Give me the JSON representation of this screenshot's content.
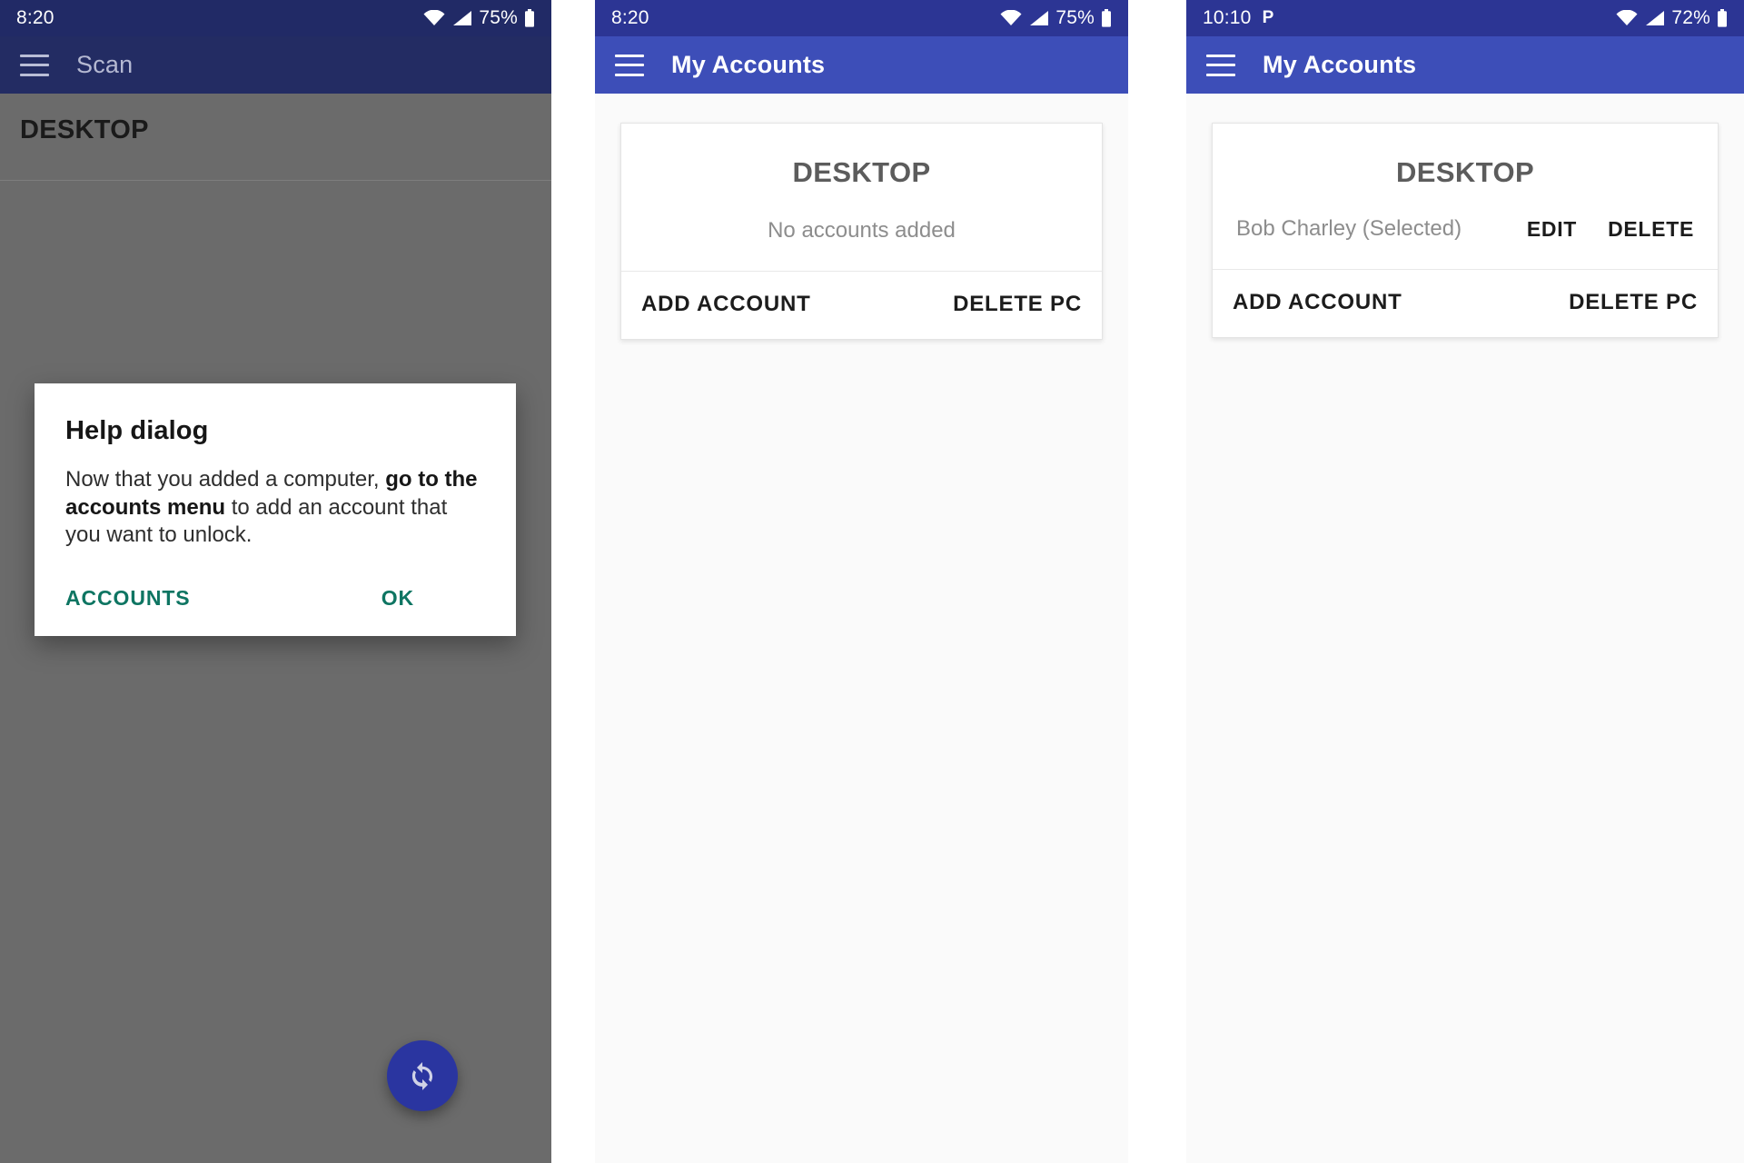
{
  "panels": [
    {
      "id": "scan-help",
      "statusbar": {
        "time": "8:20",
        "pin": "",
        "battery": "75%"
      },
      "appbar": {
        "title": "Scan",
        "menu_icon": "hamburger-menu-icon"
      },
      "section_title": "DESKTOP",
      "dialog": {
        "title": "Help dialog",
        "body_part1": "Now that you added a computer, ",
        "body_bold": "go to the accounts menu",
        "body_part2": " to add an account that you want to unlock.",
        "accounts_label": "ACCOUNTS",
        "ok_label": "OK",
        "accent_color": "#0e7562"
      },
      "fab": {
        "icon": "sync-refresh-icon",
        "color": "#2a35a0"
      }
    },
    {
      "id": "accounts-empty",
      "statusbar": {
        "time": "8:20",
        "pin": "",
        "battery": "75%"
      },
      "appbar": {
        "title": "My Accounts",
        "menu_icon": "hamburger-menu-icon"
      },
      "card": {
        "title": "DESKTOP",
        "empty_text": "No accounts added",
        "add_account_label": "ADD ACCOUNT",
        "delete_pc_label": "DELETE PC"
      }
    },
    {
      "id": "accounts-filled",
      "statusbar": {
        "time": "10:10",
        "pin": "P",
        "battery": "72%"
      },
      "appbar": {
        "title": "My Accounts",
        "menu_icon": "hamburger-menu-icon"
      },
      "card": {
        "title": "DESKTOP",
        "account_name": "Bob Charley (Selected)",
        "edit_label": "EDIT",
        "delete_label": "DELETE",
        "add_account_label": "ADD ACCOUNT",
        "delete_pc_label": "DELETE PC"
      }
    }
  ],
  "colors": {
    "statusbar_dark": "#212a66",
    "statusbar_blue": "#2c3594",
    "appbar_blue": "#3d4eb8",
    "scrim": "#6b6b6b",
    "accent_teal": "#0e7562"
  }
}
